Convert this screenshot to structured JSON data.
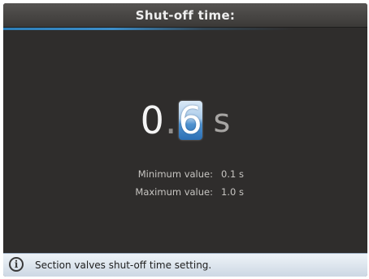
{
  "header": {
    "title": "Shut-off time:"
  },
  "value_editor": {
    "integer_part": "0",
    "decimal_separator": ".",
    "selected_digit": "6",
    "unit": "s"
  },
  "limits": {
    "minimum_label": "Minimum value:",
    "minimum_value": "0.1 s",
    "maximum_label": "Maximum value:",
    "maximum_value": "1.0 s"
  },
  "status_bar": {
    "icon": "info-icon",
    "message": "Section valves shut-off time setting."
  },
  "colors": {
    "background": "#2f2d2c",
    "accent": "#3c8ec9",
    "status_bar": "#dde5ee"
  }
}
